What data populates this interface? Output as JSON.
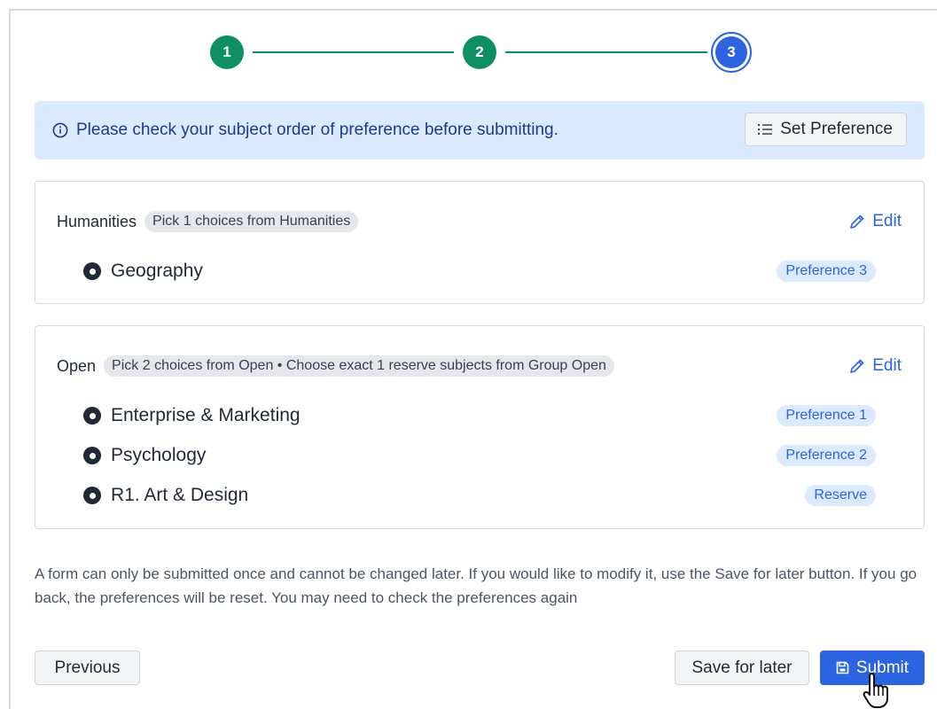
{
  "stepper": {
    "steps": [
      {
        "label": "1",
        "state": "complete"
      },
      {
        "label": "2",
        "state": "complete"
      },
      {
        "label": "3",
        "state": "active"
      }
    ]
  },
  "banner": {
    "icon": "info-icon",
    "message": "Please check your subject order of preference before submitting.",
    "set_preference_label": "Set Preference"
  },
  "groups": [
    {
      "name": "Humanities",
      "rule": "Pick 1 choices from Humanities",
      "edit_label": "Edit",
      "subjects": [
        {
          "name": "Geography",
          "badge": "Preference 3"
        }
      ]
    },
    {
      "name": "Open",
      "rule": "Pick 2 choices from Open • Choose exact 1 reserve subjects from Group Open",
      "edit_label": "Edit",
      "subjects": [
        {
          "name": "Enterprise & Marketing",
          "badge": "Preference 1"
        },
        {
          "name": "Psychology",
          "badge": "Preference 2"
        },
        {
          "name": "R1. Art & Design",
          "badge": "Reserve"
        }
      ]
    }
  ],
  "note": "A form can only be submitted once and cannot be changed later. If you would like to modify it, use the Save for later button. If you go back, the preferences will be reset. You may need to check the preferences again",
  "actions": {
    "previous_label": "Previous",
    "save_label": "Save for later",
    "submit_label": "Submit"
  },
  "colors": {
    "step_complete": "#0e8f63",
    "step_active": "#2b63e0",
    "banner_bg": "#dbeafe",
    "primary": "#2b63e0"
  }
}
